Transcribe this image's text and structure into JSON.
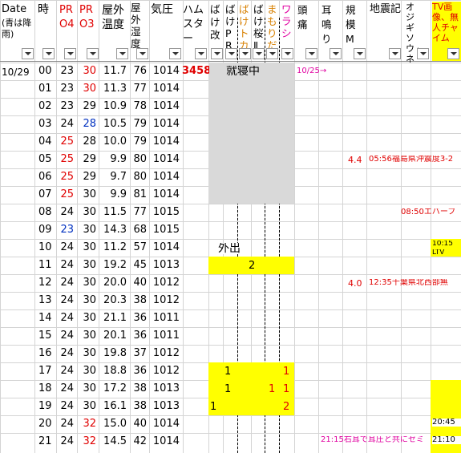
{
  "headers": {
    "date": "Date",
    "date_note": "(青は降雨)",
    "hour": "時",
    "pr04": "PRO4",
    "pr03": "PRO3",
    "outside_temp": "屋外温度",
    "outside_hum": "屋外湿度",
    "pressure": "気圧",
    "hamster": "ハムスター",
    "bake_kai": "ばけ改",
    "bake_pr": "ばけPR",
    "bake_ka": "ばけトカ",
    "bake_sakura": "ばけ桜Ⅱ",
    "mamorida": "まもりだ",
    "warashi": "ワラシ",
    "headache": "頭痛",
    "tinnitus": "耳鳴り",
    "scale": "規模M",
    "earthquake": "地震記",
    "ojizo": "オジギソウ・ネ",
    "tv": "TV画像、無人チャイム"
  },
  "date_value": "10/29",
  "hamster_value": "3458",
  "sleep_label": "就寝中",
  "out_label": "外出",
  "headache_note": "10/25→",
  "rows": [
    {
      "h": "00",
      "p4": "23",
      "p3": "30",
      "t": "11.7",
      "hu": "76",
      "pr": "1014"
    },
    {
      "h": "01",
      "p4": "23",
      "p3": "30",
      "t": "11.3",
      "hu": "77",
      "pr": "1014"
    },
    {
      "h": "02",
      "p4": "23",
      "p3": "29",
      "t": "10.9",
      "hu": "78",
      "pr": "1014"
    },
    {
      "h": "03",
      "p4": "24",
      "p3": "28",
      "t": "10.5",
      "hu": "79",
      "pr": "1014"
    },
    {
      "h": "04",
      "p4": "25",
      "p3": "28",
      "t": "10.0",
      "hu": "79",
      "pr": "1014"
    },
    {
      "h": "05",
      "p4": "25",
      "p3": "29",
      "t": "9.9",
      "hu": "80",
      "pr": "1014"
    },
    {
      "h": "06",
      "p4": "25",
      "p3": "29",
      "t": "9.7",
      "hu": "80",
      "pr": "1014"
    },
    {
      "h": "07",
      "p4": "25",
      "p3": "30",
      "t": "9.9",
      "hu": "81",
      "pr": "1014"
    },
    {
      "h": "08",
      "p4": "24",
      "p3": "30",
      "t": "11.5",
      "hu": "77",
      "pr": "1015"
    },
    {
      "h": "09",
      "p4": "23",
      "p3": "30",
      "t": "14.3",
      "hu": "68",
      "pr": "1015"
    },
    {
      "h": "10",
      "p4": "24",
      "p3": "30",
      "t": "11.2",
      "hu": "57",
      "pr": "1014"
    },
    {
      "h": "11",
      "p4": "24",
      "p3": "30",
      "t": "19.2",
      "hu": "45",
      "pr": "1013"
    },
    {
      "h": "12",
      "p4": "24",
      "p3": "30",
      "t": "20.0",
      "hu": "40",
      "pr": "1012"
    },
    {
      "h": "13",
      "p4": "24",
      "p3": "30",
      "t": "20.3",
      "hu": "38",
      "pr": "1012"
    },
    {
      "h": "14",
      "p4": "24",
      "p3": "30",
      "t": "21.1",
      "hu": "36",
      "pr": "1011"
    },
    {
      "h": "15",
      "p4": "24",
      "p3": "30",
      "t": "20.1",
      "hu": "36",
      "pr": "1011"
    },
    {
      "h": "16",
      "p4": "24",
      "p3": "30",
      "t": "19.8",
      "hu": "37",
      "pr": "1012"
    },
    {
      "h": "17",
      "p4": "24",
      "p3": "30",
      "t": "18.8",
      "hu": "36",
      "pr": "1012"
    },
    {
      "h": "18",
      "p4": "24",
      "p3": "30",
      "t": "17.2",
      "hu": "38",
      "pr": "1013"
    },
    {
      "h": "19",
      "p4": "24",
      "p3": "30",
      "t": "16.1",
      "hu": "38",
      "pr": "1013"
    },
    {
      "h": "20",
      "p4": "24",
      "p3": "32",
      "t": "15.0",
      "hu": "40",
      "pr": "1014"
    },
    {
      "h": "21",
      "p4": "24",
      "p3": "32",
      "t": "14.5",
      "hu": "42",
      "pr": "1014"
    }
  ],
  "p4_colors": [
    "#000000",
    "#000000",
    "#000000",
    "#000000",
    "#e00000",
    "#e00000",
    "#e00000",
    "#e00000",
    "#000000",
    "#0030c0",
    "#000000",
    "#000000",
    "#000000",
    "#000000",
    "#000000",
    "#000000",
    "#000000",
    "#000000",
    "#000000",
    "#000000",
    "#000000",
    "#000000"
  ],
  "p3_colors": [
    "#e00000",
    "#e00000",
    "#000000",
    "#0030c0",
    "#000000",
    "#000000",
    "#000000",
    "#000000",
    "#000000",
    "#000000",
    "#000000",
    "#000000",
    "#000000",
    "#000000",
    "#000000",
    "#000000",
    "#000000",
    "#000000",
    "#000000",
    "#000000",
    "#e00000",
    "#e00000"
  ],
  "marks": {
    "bake_pr_11": "2",
    "bake_kai_17": "1",
    "warashi_17": "1",
    "bake_kai_18": "1",
    "mamorida_18": "1",
    "warashi_18": "1",
    "hamster_19": "1",
    "warashi_19": "2"
  },
  "quake1_scale": "4.4",
  "quake1_text": "05:56福島県沖震度3-2",
  "quake2_scale": "4.0",
  "quake2_text": "12:35千葉県北西部無",
  "ojizo_note": "08:50エバーフ",
  "tv_10": "10:15",
  "tv_10b": "LTV",
  "tv_20": "20:45",
  "tv_21": "21:10",
  "note_21": "21:15右耳で耳圧と共にセミ"
}
